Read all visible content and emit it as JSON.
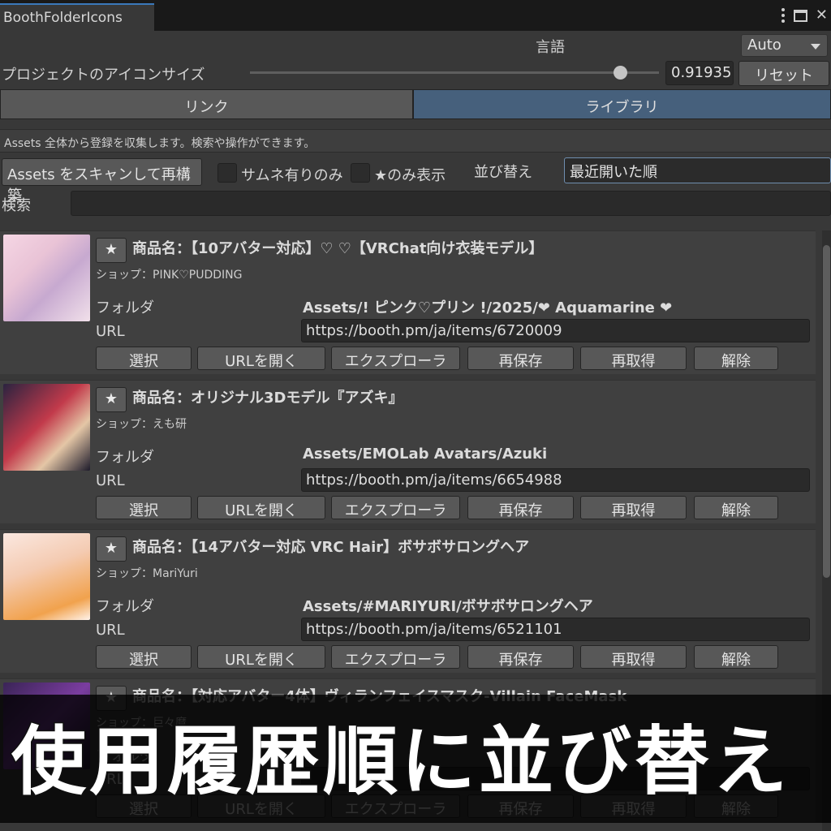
{
  "window": {
    "tab_title": "BoothFolderIcons"
  },
  "settings": {
    "language_label": "言語",
    "language_value": "Auto",
    "icon_size_label": "プロジェクトのアイコンサイズ",
    "icon_size_value": "0.91935",
    "icon_size_fraction": 0.91935,
    "reset_label": "リセット"
  },
  "tabs": [
    {
      "label": "リンク",
      "active": false
    },
    {
      "label": "ライブラリ",
      "active": true
    }
  ],
  "description": "Assets 全体から登録を収集します。検索や操作ができます。",
  "toolbar": {
    "scan_label": "Assets をスキャンして再構築",
    "thumb_only_label": "サムネ有りのみ",
    "star_only_label": "★のみ表示",
    "sort_label": "並び替え",
    "sort_value": "最近開いた順",
    "search_label": "検索",
    "search_value": ""
  },
  "labels": {
    "star": "★",
    "folder": "フォルダ",
    "url": "URL",
    "actions": [
      "選択",
      "URLを開く",
      "エクスプローラ",
      "再保存",
      "再取得",
      "解除"
    ]
  },
  "items": [
    {
      "title": "商品名：【10アバター対応】♡ ♡【VRChat向け衣装モデル】",
      "shop": "ショップ：PINK♡PUDDING",
      "folder": "Assets/! ピンク♡プリン !/2025/❤ Aquamarine ❤",
      "url": "https://booth.pm/ja/items/6720009"
    },
    {
      "title": "商品名：オリジナル3Dモデル『アズキ』",
      "shop": "ショップ：えも研",
      "folder": "Assets/EMOLab Avatars/Azuki",
      "url": "https://booth.pm/ja/items/6654988"
    },
    {
      "title": "商品名：【14アバター対応 VRC Hair】ボサボサロングヘア",
      "shop": "ショップ：MariYuri",
      "folder": "Assets/#MARIYURI/ボサボサロングヘア",
      "url": "https://booth.pm/ja/items/6521101"
    },
    {
      "title": "商品名：【対応アバター4体】ヴィランフェイスマスク-Villain FaceMask",
      "shop": "ショップ：巨々麿",
      "folder": "",
      "url": ""
    }
  ],
  "banner": {
    "text": "使用履歴順に並び替え"
  }
}
